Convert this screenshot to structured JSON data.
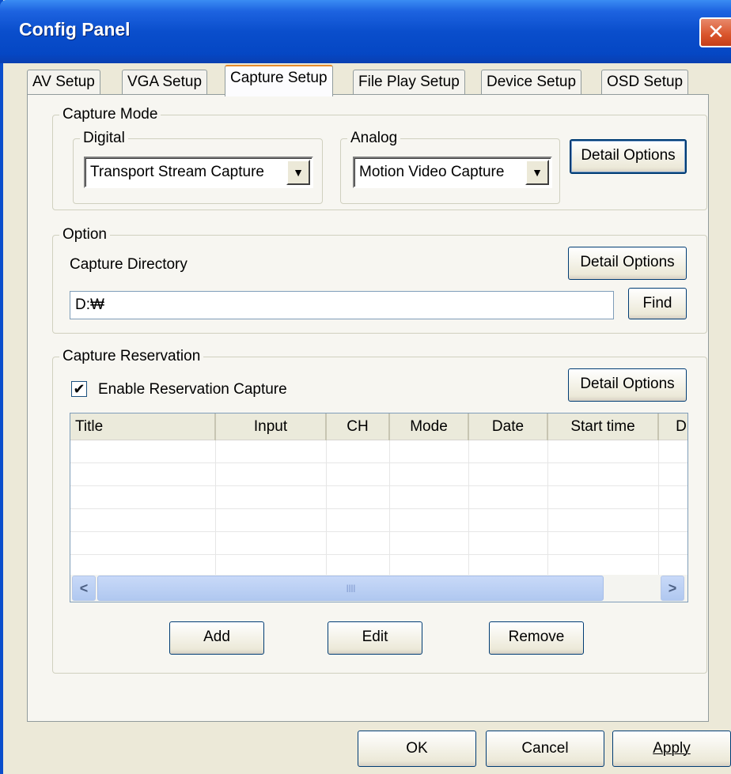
{
  "window": {
    "title": "Config Panel",
    "close_glyph": "✕"
  },
  "tabs": [
    {
      "label": "AV Setup"
    },
    {
      "label": "VGA Setup"
    },
    {
      "label": "Capture Setup"
    },
    {
      "label": "File Play Setup"
    },
    {
      "label": "Device Setup"
    },
    {
      "label": "OSD Setup"
    }
  ],
  "capture_mode": {
    "legend": "Capture Mode",
    "digital": {
      "legend": "Digital",
      "selected": "Transport Stream Capture"
    },
    "analog": {
      "legend": "Analog",
      "selected": "Motion Video Capture"
    },
    "detail_button": "Detail Options"
  },
  "option": {
    "legend": "Option",
    "directory_label": "Capture Directory",
    "detail_button": "Detail Options",
    "directory_value": "D:₩",
    "find_button": "Find"
  },
  "reservation": {
    "legend": "Capture Reservation",
    "enable_label": "Enable Reservation Capture",
    "enable_checked": true,
    "detail_button": "Detail Options",
    "columns": [
      "Title",
      "Input",
      "CH",
      "Mode",
      "Date",
      "Start time",
      "D"
    ],
    "scroll_left": "<",
    "scroll_right": ">",
    "scroll_grip": "IIII",
    "add_button": "Add",
    "edit_button": "Edit",
    "remove_button": "Remove"
  },
  "footer": {
    "ok": "OK",
    "cancel": "Cancel",
    "apply": "Apply"
  }
}
